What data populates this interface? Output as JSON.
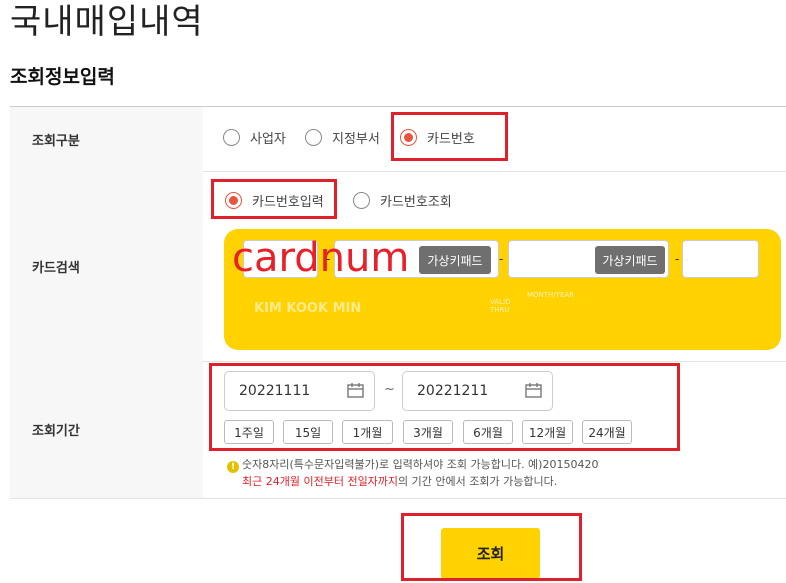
{
  "page_title": "국내매입내역",
  "section_title": "조회정보입력",
  "rows": {
    "type": {
      "label": "조회구분",
      "options": [
        "사업자",
        "지정부서",
        "카드번호"
      ],
      "selected": "카드번호"
    },
    "card": {
      "label": "카드검색",
      "options": [
        "카드번호입력",
        "카드번호조회"
      ],
      "selected": "카드번호입력",
      "virtual_keypad_label": "가상키패드",
      "dash": "-",
      "holder_name": "KIM KOOK MIN",
      "valid_thru": "VALID\nTHRU",
      "month_year": "MONTH/YEAR",
      "overlay_text": "cardnum",
      "card_color": "#ffd200"
    },
    "period": {
      "label": "조회기간",
      "start_date": "20221111",
      "end_date": "20221211",
      "separator": "~",
      "quick_buttons": [
        "1주일",
        "15일",
        "1개월",
        "3개월",
        "6개월",
        "12개월",
        "24개월"
      ],
      "note_icon": "!",
      "note1": "숫자8자리(특수문자입력불가)로 입력하셔야 조회 가능합니다. 예)20150420",
      "note2_highlight": "최근 24개월 이전부터 전일자까지",
      "note2_rest": "의 기간 안에서 조회가 가능합니다."
    }
  },
  "search_button_label": "조회",
  "colors": {
    "accent_yellow": "#ffd200",
    "radio_red": "#e8553e",
    "highlight_red": "#e0202a"
  }
}
